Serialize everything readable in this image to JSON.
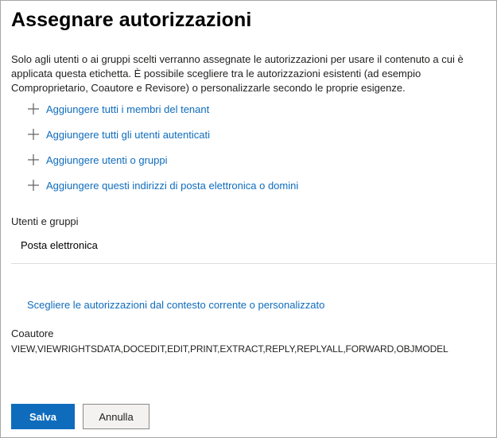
{
  "page": {
    "title": "Assegnare autorizzazioni",
    "description": "Solo agli utenti o ai gruppi scelti verranno assegnate le autorizzazioni per usare il contenuto a cui è applicata questa etichetta. È possibile scegliere tra le autorizzazioni esistenti (ad esempio Comproprietario, Coautore e Revisore) o personalizzarle secondo le proprie esigenze."
  },
  "add_actions": [
    {
      "label": "Aggiungere tutti i membri del tenant",
      "icon": "plus-icon"
    },
    {
      "label": "Aggiungere tutti gli utenti autenticati",
      "icon": "plus-icon"
    },
    {
      "label": "Aggiungere utenti o gruppi",
      "icon": "plus-icon"
    },
    {
      "label": "Aggiungere questi indirizzi di posta elettronica o domini",
      "icon": "plus-icon"
    }
  ],
  "users_section": {
    "label": "Utenti e gruppi",
    "rows": [
      "Posta elettronica"
    ]
  },
  "permissions": {
    "choose_link": "Scegliere le autorizzazioni dal contesto corrente o personalizzato",
    "name": "Coautore",
    "rights": "VIEW,VIEWRIGHTSDATA,DOCEDIT,EDIT,PRINT,EXTRACT,REPLY,REPLYALL,FORWARD,OBJMODEL"
  },
  "buttons": {
    "save": "Salva",
    "cancel": "Annulla"
  },
  "colors": {
    "accent": "#0f6cbd",
    "text": "#201f1e",
    "divider": "#e1dfdd"
  }
}
